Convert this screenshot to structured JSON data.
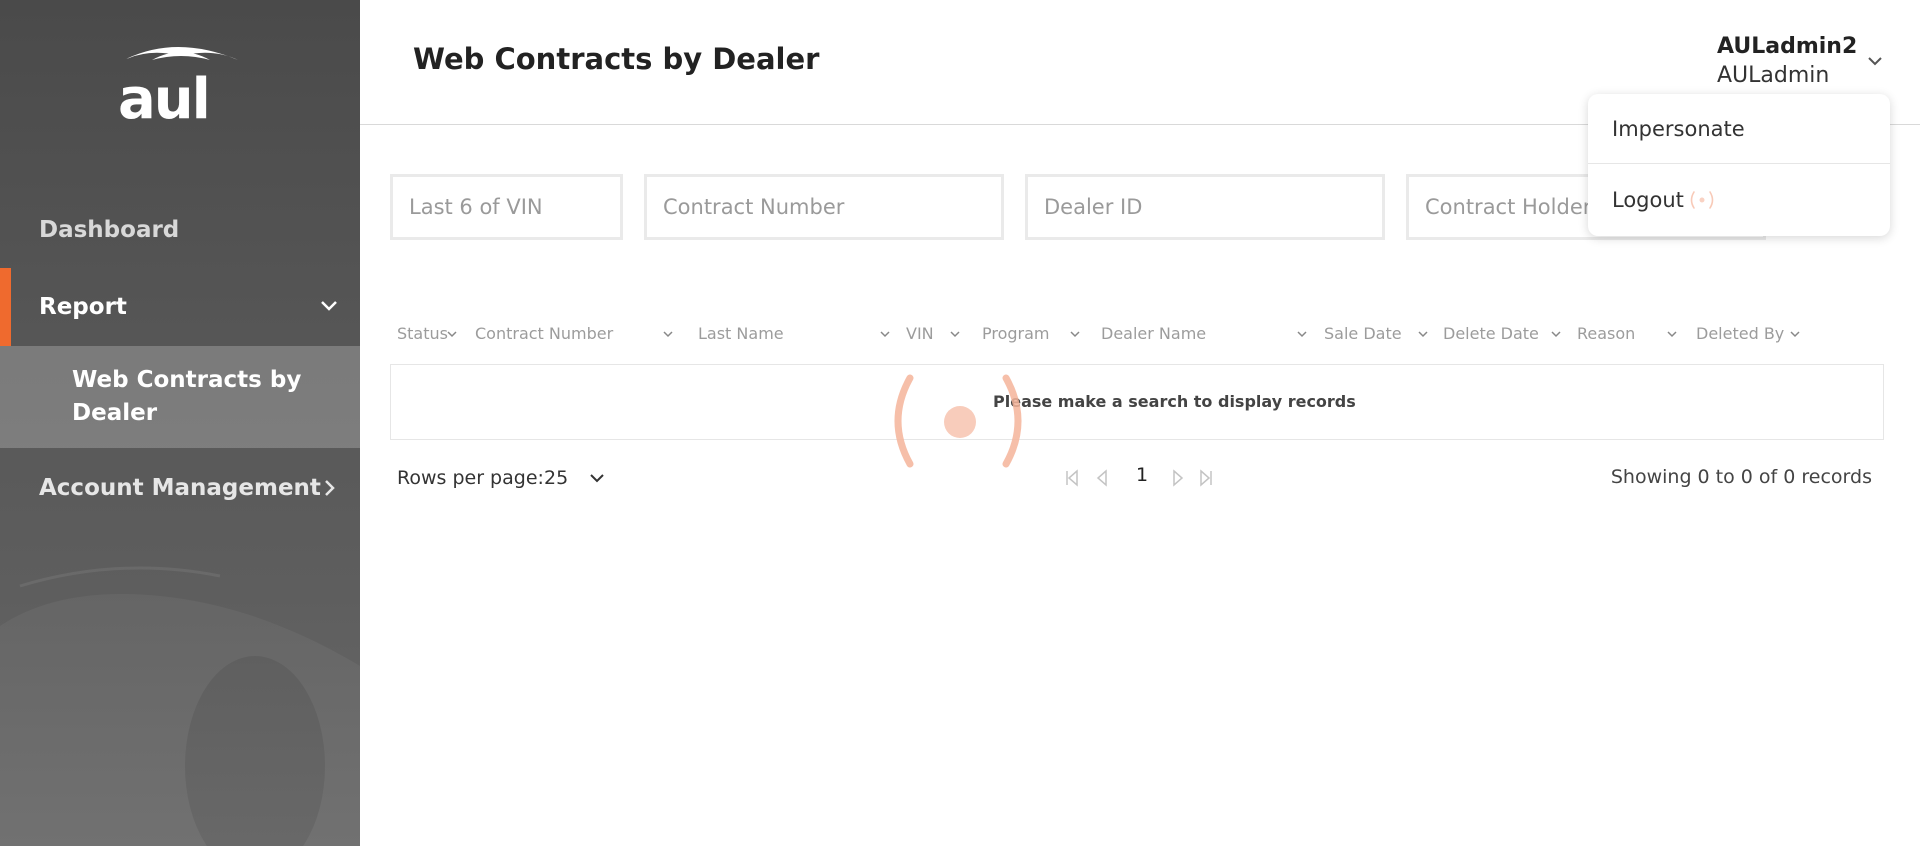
{
  "sidebar": {
    "logo_text": "aul",
    "items": [
      {
        "label": "Dashboard"
      },
      {
        "label": "Report"
      },
      {
        "label": "Web Contracts by Dealer"
      },
      {
        "label": "Account Management"
      }
    ]
  },
  "header": {
    "title": "Web Contracts by Dealer",
    "user_name": "AULadmin2",
    "user_role": "AULadmin"
  },
  "search": {
    "vin_placeholder": "Last 6 of VIN",
    "contract_placeholder": "Contract Number",
    "dealer_placeholder": "Dealer ID",
    "holder_placeholder": "Contract Holder"
  },
  "table": {
    "columns": [
      "Status",
      "Contract Number",
      "Last Name",
      "VIN",
      "Program",
      "Dealer Name",
      "Sale Date",
      "Delete Date",
      "Reason",
      "Deleted By"
    ],
    "empty_message": "Please make a search to display records"
  },
  "pagination": {
    "rows_label": "Rows per page:",
    "rows_value": "25",
    "current_page": "1",
    "showing": "Showing 0 to 0 of 0 records"
  },
  "user_menu": {
    "items": [
      {
        "label": "Impersonate"
      },
      {
        "label": "Logout"
      }
    ]
  },
  "colors": {
    "accent": "#ef6a2e",
    "spinner": "#f5b49a",
    "sidebar": "#555555"
  }
}
